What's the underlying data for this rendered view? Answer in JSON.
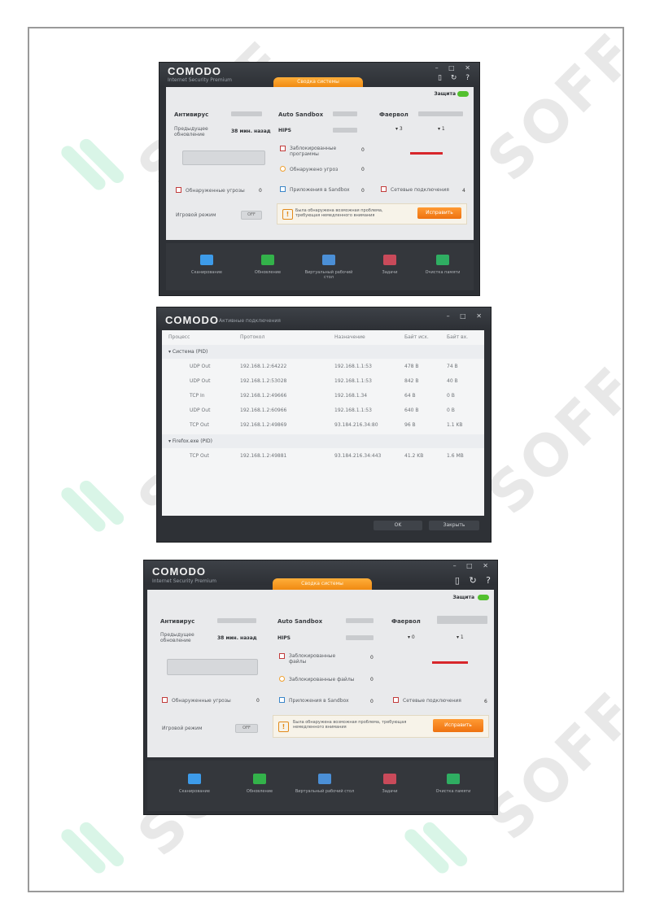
{
  "screenshot1": {
    "brand": "COMODO",
    "brand_sub": "Internet Security Premium",
    "tab": "Сводка системы",
    "badge": "Защита",
    "antivirus_label": "Антивирус",
    "scan_last_label": "Предыдущее обновление",
    "scan_last_value": "38 мин. назад",
    "sandbox_label": "Auto Sandbox",
    "hips_label": "HIPS",
    "firewall_label": "Фаервол",
    "item_threats": "Обнаруженные угрозы",
    "item_threats_count": "0",
    "item_blocked": "Заблокированные программы",
    "item_blocked_count": "0",
    "item_sandboxed": "Приложения в Sandbox",
    "item_sandboxed_count": "0",
    "item_fw": "Сетевые подключения",
    "item_fw_count": "4",
    "item_detected": "Обнаружено угроз",
    "item_detected_count": "0",
    "game_mode_label": "Игровой режим",
    "game_mode_state": "OFF",
    "alert_text": "Была обнаружена возможная проблема, требующая немедленного внимания",
    "alert_button": "Исправить",
    "dock": [
      "Сканирование",
      "Обновление",
      "Виртуальный рабочий стол",
      "Задачи",
      "Очистка памяти"
    ]
  },
  "screenshot2": {
    "brand": "COMODO",
    "brand_sub": "Активные подключения",
    "columns": [
      "Процесс",
      "Протокол",
      "Назначение",
      "Байт исх.",
      "Байт вх."
    ],
    "groups": [
      {
        "name": "Система (PID)",
        "rows": [
          {
            "proto": "UDP Out",
            "src": "192.168.1.2:64222",
            "dst": "192.168.1.1:53",
            "out": "478 B",
            "in": "74 B"
          },
          {
            "proto": "UDP Out",
            "src": "192.168.1.2:53028",
            "dst": "192.168.1.1:53",
            "out": "842 B",
            "in": "40 B"
          },
          {
            "proto": "TCP In",
            "src": "192.168.1.2:49666",
            "dst": "192.168.1.34",
            "out": "64 B",
            "in": "0 B"
          },
          {
            "proto": "UDP Out",
            "src": "192.168.1.2:60966",
            "dst": "192.168.1.1:53",
            "out": "640 B",
            "in": "0 B"
          },
          {
            "proto": "TCP Out",
            "src": "192.168.1.2:49869",
            "dst": "93.184.216.34:80",
            "out": "96 B",
            "in": "1.1 KB"
          }
        ]
      },
      {
        "name": "Firefox.exe (PID)",
        "rows": [
          {
            "proto": "TCP Out",
            "src": "192.168.1.2:49881",
            "dst": "93.184.216.34:443",
            "out": "41.2 KB",
            "in": "1.6 MB"
          }
        ]
      }
    ],
    "btn_ok": "OK",
    "btn_close": "Закрыть"
  },
  "screenshot3": {
    "brand": "COMODO",
    "brand_sub": "Internet Security Premium",
    "tab": "Сводка системы",
    "badge": "Защита",
    "antivirus_label": "Антивирус",
    "scan_last_label": "Предыдущее обновление",
    "scan_last_value": "38 мин. назад",
    "sandbox_label": "Auto Sandbox",
    "hips_label": "HIPS",
    "firewall_label": "Фаервол",
    "item_threats": "Обнаруженные угрозы",
    "item_threats_count": "0",
    "item_blocked": "Заблокированные файлы",
    "item_blocked_count": "0",
    "item_sandboxed": "Приложения в Sandbox",
    "item_sandboxed_count": "0",
    "item_fw": "Сетевые подключения",
    "item_fw_count": "6",
    "game_mode_label": "Игровой режим",
    "game_mode_state": "OFF",
    "alert_text": "Была обнаружена возможная проблема, требующая немедленного внимания",
    "alert_button": "Исправить",
    "dock": [
      "Сканирование",
      "Обновление",
      "Виртуальный рабочий стол",
      "Задачи",
      "Очистка памяти"
    ]
  },
  "watermark": "SOFF"
}
